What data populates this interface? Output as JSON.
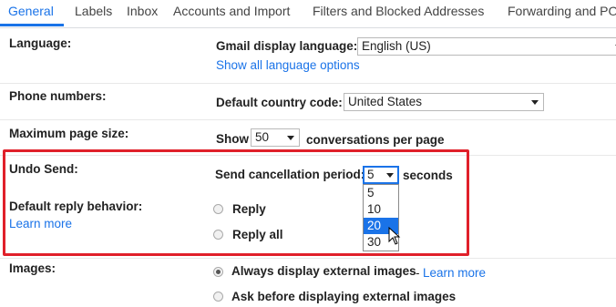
{
  "tabs": [
    "General",
    "Labels",
    "Inbox",
    "Accounts and Import",
    "Filters and Blocked Addresses",
    "Forwarding and PO"
  ],
  "rows": {
    "language": {
      "label": "Language:",
      "display_label": "Gmail display language:",
      "display_value": "English (US)",
      "link": "Show all language options"
    },
    "phone": {
      "label": "Phone numbers:",
      "country_label": "Default country code:",
      "country_value": "United States"
    },
    "page_size": {
      "label": "Maximum page size:",
      "prefix": "Show",
      "value": "50",
      "suffix": "conversations per page"
    },
    "undo_send": {
      "label": "Undo Send:",
      "period_label": "Send cancellation period:",
      "value": "5",
      "suffix": "seconds",
      "options": [
        "5",
        "10",
        "20",
        "30"
      ],
      "highlighted_option": "20"
    },
    "reply": {
      "label": "Default reply behavior:",
      "learn_more": "Learn more",
      "options": [
        "Reply",
        "Reply all"
      ]
    },
    "images": {
      "label": "Images:",
      "option_always": "Always display external images",
      "separator": "-",
      "learn_more": "Learn more",
      "option_ask": "Ask before displaying external images"
    }
  },
  "colors": {
    "accent": "#1a73e8",
    "highlight_border": "#e0202a"
  }
}
